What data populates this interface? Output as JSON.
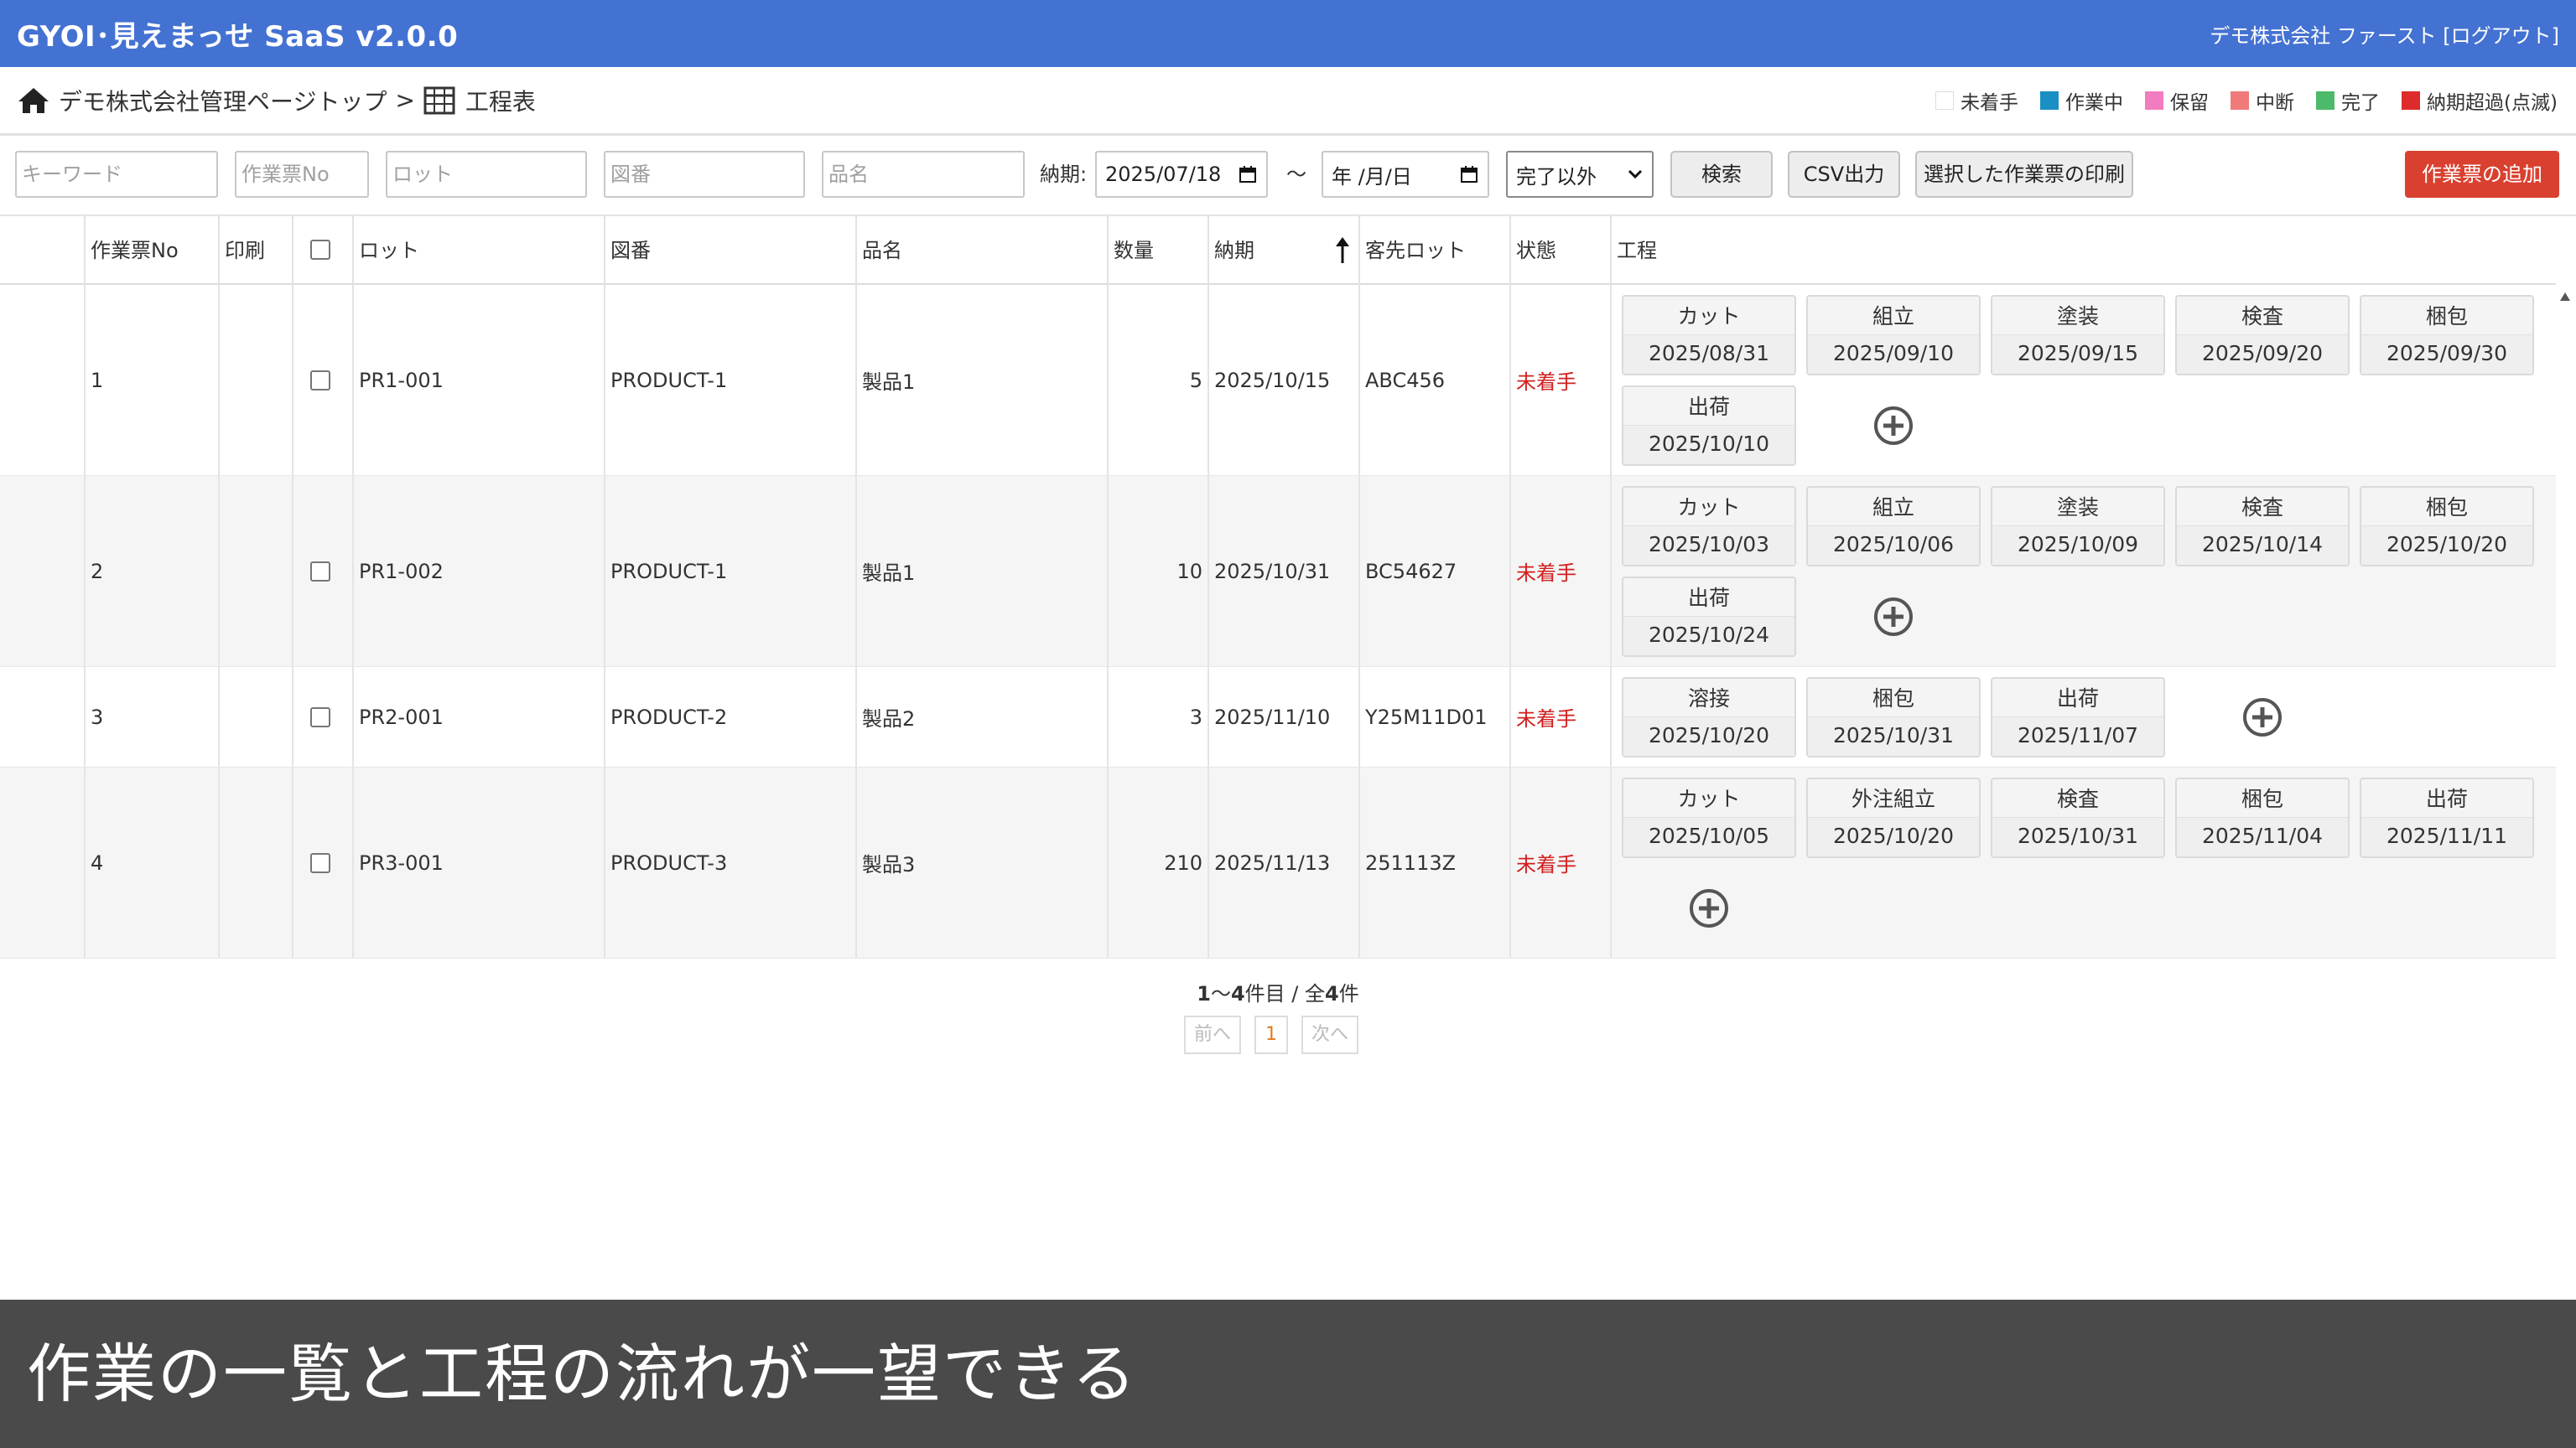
{
  "header": {
    "app_title": "GYOI･見えまっせ SaaS v2.0.0",
    "user_info": "デモ株式会社 ファースト [ログアウト]"
  },
  "breadcrumb": {
    "home_icon": "home-icon",
    "home_label": "デモ株式会社管理ページトップ",
    "separator": ">",
    "table_icon": "table-icon",
    "current_label": "工程表"
  },
  "legend": [
    {
      "label": "未着手",
      "color": "#ffffff"
    },
    {
      "label": "作業中",
      "color": "#1a8fc4"
    },
    {
      "label": "保留",
      "color": "#f27cc0"
    },
    {
      "label": "中断",
      "color": "#f07a7a"
    },
    {
      "label": "完了",
      "color": "#4cba6a"
    },
    {
      "label": "納期超過(点滅)",
      "color": "#dd2b2b"
    }
  ],
  "filters": {
    "keyword_placeholder": "キーワード",
    "ticket_no_placeholder": "作業票No",
    "lot_placeholder": "ロット",
    "drawing_placeholder": "図番",
    "item_placeholder": "品名",
    "due_label": "納期:",
    "due_from": "2025/07/18",
    "range_sep": "～",
    "due_to": "年 /月/日",
    "status_selected": "完了以外",
    "search_label": "検索",
    "csv_label": "CSV出力",
    "print_label": "選択した作業票の印刷",
    "add_label": "作業票の追加"
  },
  "table": {
    "columns": {
      "ticket_no": "作業票No",
      "print": "印刷",
      "lot": "ロット",
      "drawing": "図番",
      "item": "品名",
      "qty": "数量",
      "due": "納期",
      "customer_lot": "客先ロット",
      "status": "状態",
      "process": "工程"
    },
    "rows": [
      {
        "no": "1",
        "lot": "PR1-001",
        "drawing": "PRODUCT-1",
        "item": "製品1",
        "qty": "5",
        "due": "2025/10/15",
        "customer_lot": "ABC456",
        "status": "未着手",
        "steps": [
          {
            "name": "カット",
            "date": "2025/08/31"
          },
          {
            "name": "組立",
            "date": "2025/09/10"
          },
          {
            "name": "塗装",
            "date": "2025/09/15"
          },
          {
            "name": "検査",
            "date": "2025/09/20"
          },
          {
            "name": "梱包",
            "date": "2025/09/30"
          },
          {
            "name": "出荷",
            "date": "2025/10/10"
          }
        ]
      },
      {
        "no": "2",
        "lot": "PR1-002",
        "drawing": "PRODUCT-1",
        "item": "製品1",
        "qty": "10",
        "due": "2025/10/31",
        "customer_lot": "BC54627",
        "status": "未着手",
        "steps": [
          {
            "name": "カット",
            "date": "2025/10/03"
          },
          {
            "name": "組立",
            "date": "2025/10/06"
          },
          {
            "name": "塗装",
            "date": "2025/10/09"
          },
          {
            "name": "検査",
            "date": "2025/10/14"
          },
          {
            "name": "梱包",
            "date": "2025/10/20"
          },
          {
            "name": "出荷",
            "date": "2025/10/24"
          }
        ]
      },
      {
        "no": "3",
        "lot": "PR2-001",
        "drawing": "PRODUCT-2",
        "item": "製品2",
        "qty": "3",
        "due": "2025/11/10",
        "customer_lot": "Y25M11D01",
        "status": "未着手",
        "steps": [
          {
            "name": "溶接",
            "date": "2025/10/20"
          },
          {
            "name": "梱包",
            "date": "2025/10/31"
          },
          {
            "name": "出荷",
            "date": "2025/11/07"
          }
        ]
      },
      {
        "no": "4",
        "lot": "PR3-001",
        "drawing": "PRODUCT-3",
        "item": "製品3",
        "qty": "210",
        "due": "2025/11/13",
        "customer_lot": "251113Z",
        "status": "未着手",
        "steps": [
          {
            "name": "カット",
            "date": "2025/10/05"
          },
          {
            "name": "外注組立",
            "date": "2025/10/20"
          },
          {
            "name": "検査",
            "date": "2025/10/31"
          },
          {
            "name": "梱包",
            "date": "2025/11/04"
          },
          {
            "name": "出荷",
            "date": "2025/11/11"
          }
        ]
      }
    ]
  },
  "pagination": {
    "range_start": "1",
    "range_sep": "～",
    "range_end": "4",
    "range_suffix": "件目 / 全",
    "total": "4",
    "total_suffix": "件",
    "prev_label": "前へ",
    "current_page": "1",
    "next_label": "次へ"
  },
  "caption": "作業の一覧と工程の流れが一望できる"
}
